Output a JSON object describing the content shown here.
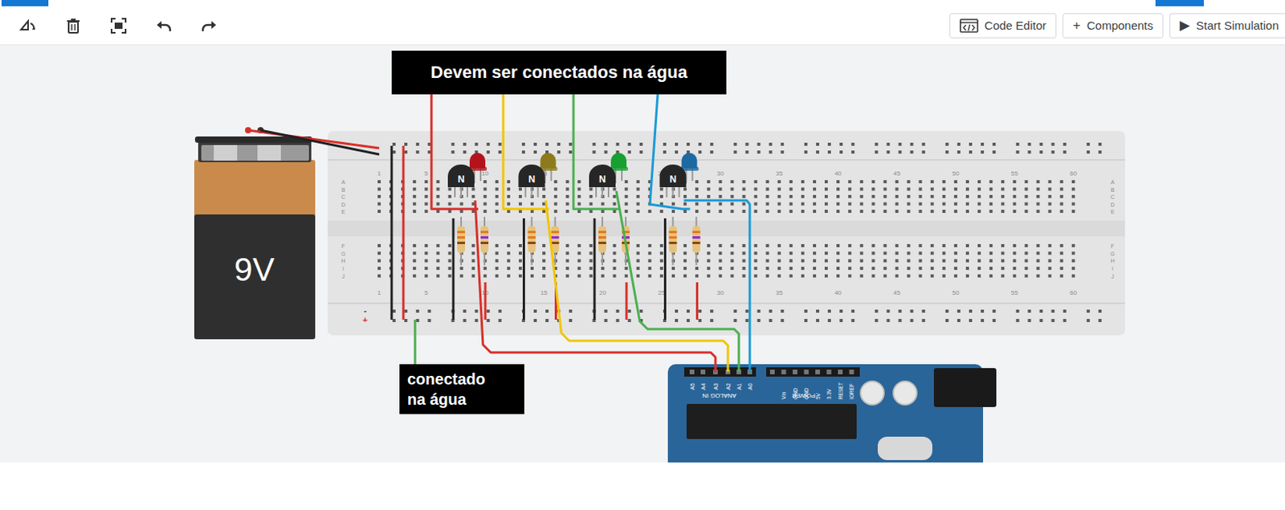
{
  "toolbar": {
    "buttons": [
      {
        "label": "Code Editor",
        "icon": ""
      },
      {
        "label": "Components",
        "icon": "+"
      },
      {
        "label": "Start Simulation",
        "icon": "▶"
      }
    ]
  },
  "annotations": [
    {
      "text": "Devem ser conectados na água"
    },
    {
      "text": "conectado na água"
    }
  ],
  "battery": {
    "label": "9V"
  },
  "breadboard": {
    "column_numbers": [
      "1",
      "5",
      "10",
      "15",
      "20",
      "25",
      "30",
      "35",
      "40",
      "45",
      "50",
      "55",
      "60"
    ],
    "row_letters": [
      "A",
      "B",
      "C",
      "D",
      "E",
      "F",
      "G",
      "H",
      "I",
      "J"
    ],
    "rail_signs": [
      "-",
      "+"
    ]
  },
  "stages": [
    {
      "transistor": "N",
      "color": "#d8302a",
      "led_color": "#b3141c"
    },
    {
      "transistor": "N",
      "color": "#f2c500",
      "led_color": "#8c7a1c"
    },
    {
      "transistor": "N",
      "color": "#4caf50",
      "led_color": "#17a02f"
    },
    {
      "transistor": "N",
      "color": "#1a9ad6",
      "led_color": "#1d6aa3"
    }
  ],
  "arduino": {
    "analog_pins": [
      "A5",
      "A4",
      "A3",
      "A2",
      "A1",
      "A0"
    ],
    "analog_label": "ANALOG IN",
    "power_pins": [
      "Vin",
      "GND",
      "GND",
      "5V",
      "3.3V",
      "RESET",
      "IOREF"
    ],
    "power_label": "POWER"
  }
}
